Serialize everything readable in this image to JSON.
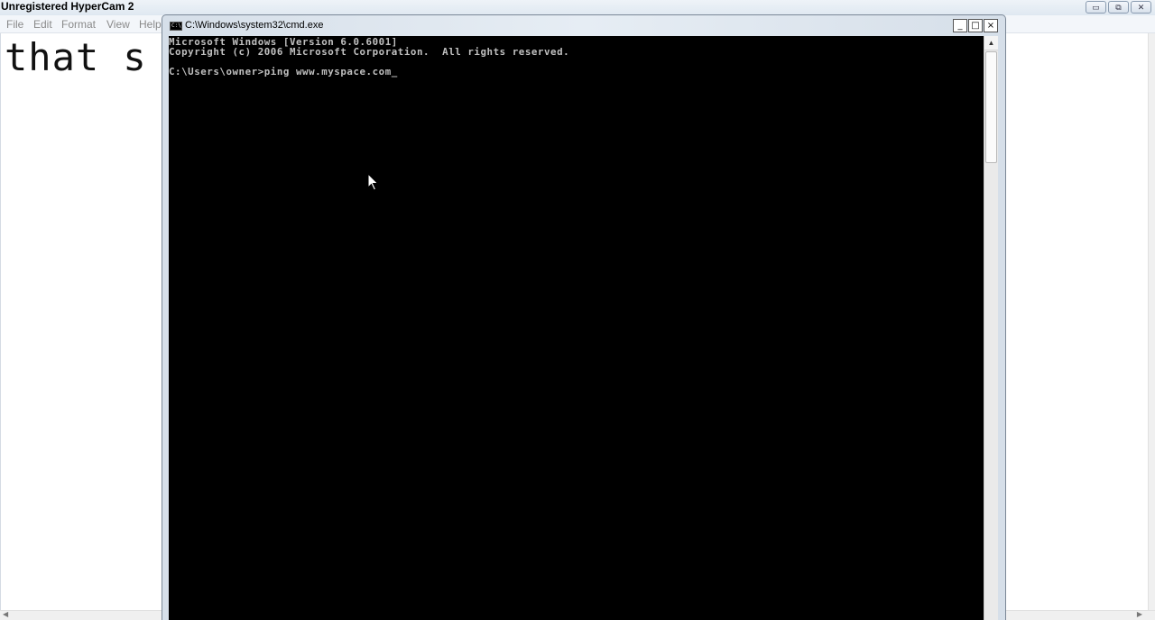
{
  "watermark": "Unregistered HyperCam 2",
  "background_app": {
    "menu": [
      "File",
      "Edit",
      "Format",
      "View",
      "Help"
    ],
    "editor_text": "that s"
  },
  "cmd": {
    "title": "C:\\Windows\\system32\\cmd.exe",
    "icon_label": "C:\\",
    "lines": [
      "Microsoft Windows [Version 6.0.6001]",
      "Copyright (c) 2006 Microsoft Corporation.  All rights reserved.",
      "",
      "C:\\Users\\owner>ping www.myspace.com"
    ],
    "cursor": "_",
    "caption_buttons": {
      "minimize": "_",
      "maximize": "□",
      "close": "×"
    }
  },
  "colors": {
    "console_bg": "#000000",
    "console_fg": "#c0c0c0"
  }
}
